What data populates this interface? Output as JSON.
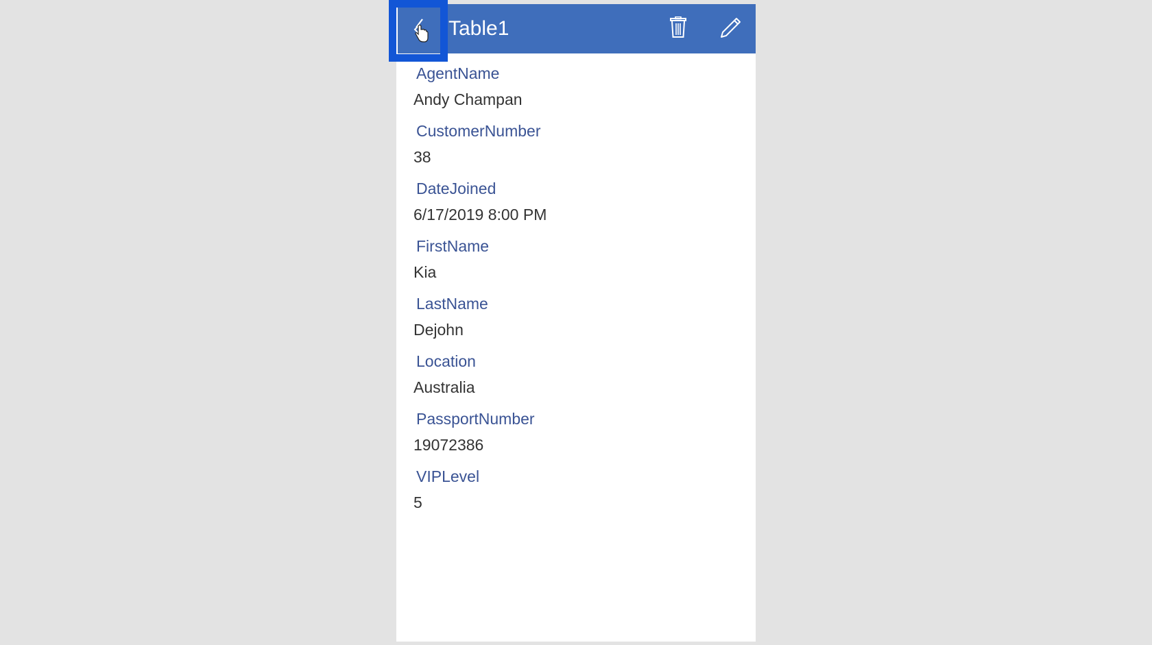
{
  "header": {
    "title": "Table1",
    "back_icon": "chevron-left-icon",
    "delete_icon": "trash-icon",
    "edit_icon": "pencil-icon"
  },
  "colors": {
    "header_bg": "#3f6ebb",
    "focus_border": "#1256d6",
    "label_text": "#3a5394",
    "value_text": "#333333",
    "page_bg": "#e3e3e3"
  },
  "fields": [
    {
      "label": "AgentName",
      "value": "Andy Champan"
    },
    {
      "label": "CustomerNumber",
      "value": "38"
    },
    {
      "label": "DateJoined",
      "value": "6/17/2019 8:00 PM"
    },
    {
      "label": "FirstName",
      "value": "Kia"
    },
    {
      "label": "LastName",
      "value": "Dejohn"
    },
    {
      "label": "Location",
      "value": "Australia"
    },
    {
      "label": "PassportNumber",
      "value": "19072386"
    },
    {
      "label": "VIPLevel",
      "value": "5"
    }
  ]
}
